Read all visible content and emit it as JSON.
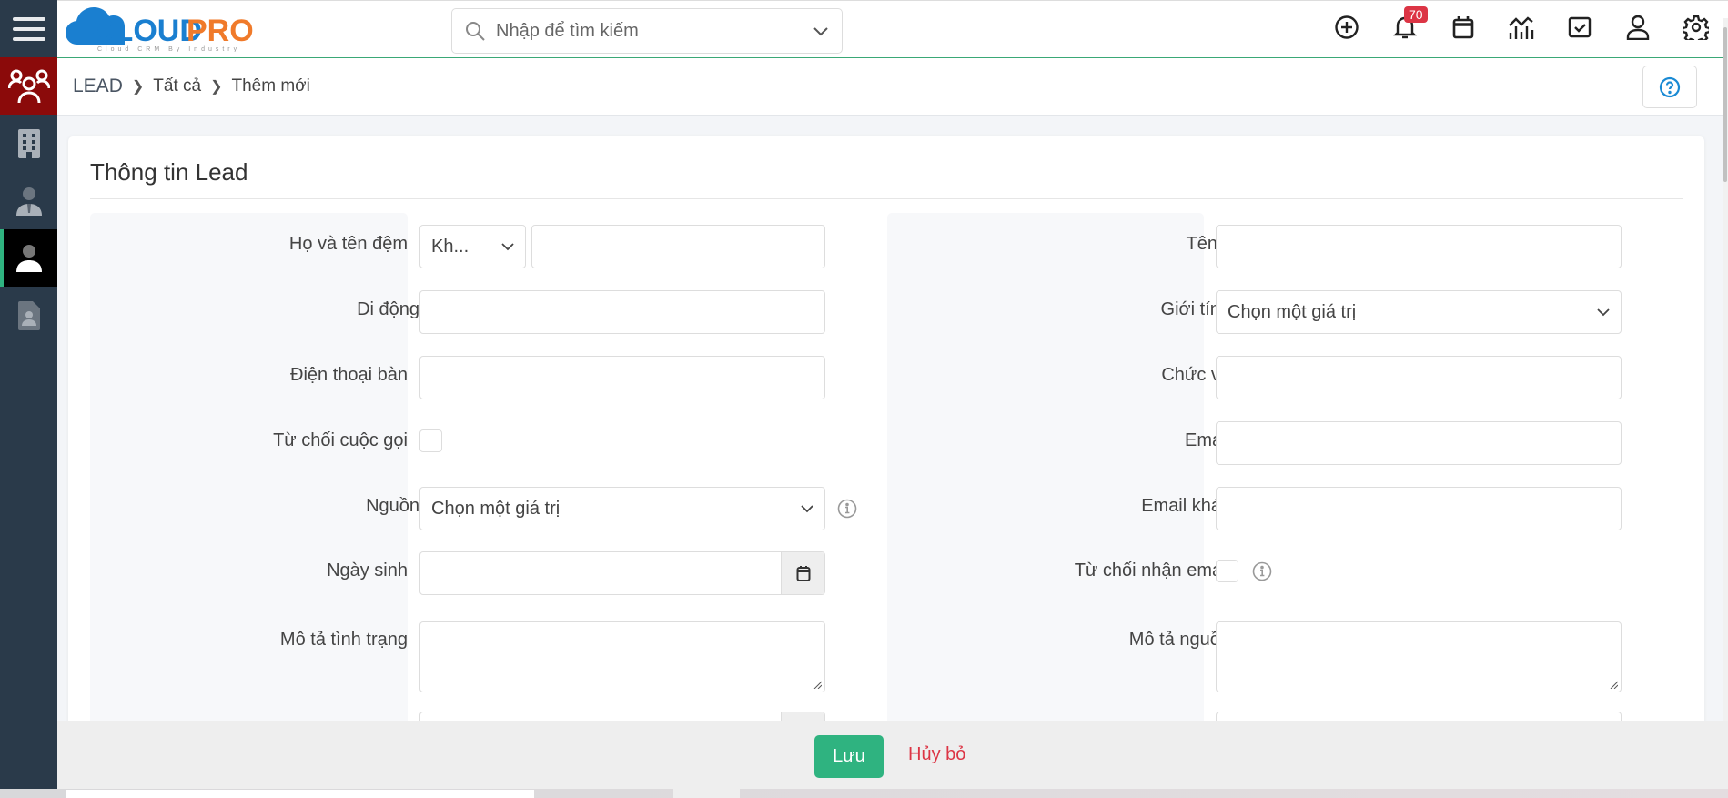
{
  "app": {
    "brand_primary": "CLOUD",
    "brand_secondary": "PRO",
    "brand_tagline": "Cloud CRM By Industry",
    "accent_color": "#2fb380",
    "danger_color": "#dc3545"
  },
  "header": {
    "search_placeholder": "Nhập để tìm kiếm",
    "notification_count": "70",
    "icons": [
      "add-circle-icon",
      "bell-icon",
      "calendar-icon",
      "chart-icon",
      "task-check-icon",
      "user-icon",
      "gear-icon"
    ]
  },
  "sidebar": {
    "items": [
      {
        "name": "leads",
        "icon": "users-group-icon"
      },
      {
        "name": "organizations",
        "icon": "building-icon"
      },
      {
        "name": "contacts",
        "icon": "businessman-icon"
      },
      {
        "name": "person",
        "icon": "person-icon",
        "active": true
      },
      {
        "name": "documents",
        "icon": "contact-file-icon"
      }
    ]
  },
  "breadcrumb": {
    "root": "LEAD",
    "level1": "Tất cả",
    "current": "Thêm mới"
  },
  "form": {
    "title": "Thông tin Lead",
    "left": {
      "full_name_label": "Họ và tên đệm",
      "salutation_value": "Kh...",
      "mobile_label": "Di động",
      "phone_label": "Điện thoại bàn",
      "do_not_call_label": "Từ chối cuộc gọi",
      "source_label": "Nguồn",
      "source_value": "Chọn một giá trị",
      "birthday_label": "Ngày sinh",
      "status_desc_label": "Mô tả tình trạng"
    },
    "right": {
      "first_name_label": "Tên",
      "gender_label": "Giới tính",
      "gender_value": "Chọn một giá trị",
      "title_label": "Chức vụ",
      "email_label": "Email",
      "other_email_label": "Email khác",
      "email_optout_label": "Từ chối nhận email",
      "source_desc_label": "Mô tả nguồn"
    },
    "required_mark": "*"
  },
  "footer": {
    "save_label": "Lưu",
    "cancel_label": "Hủy bỏ"
  }
}
